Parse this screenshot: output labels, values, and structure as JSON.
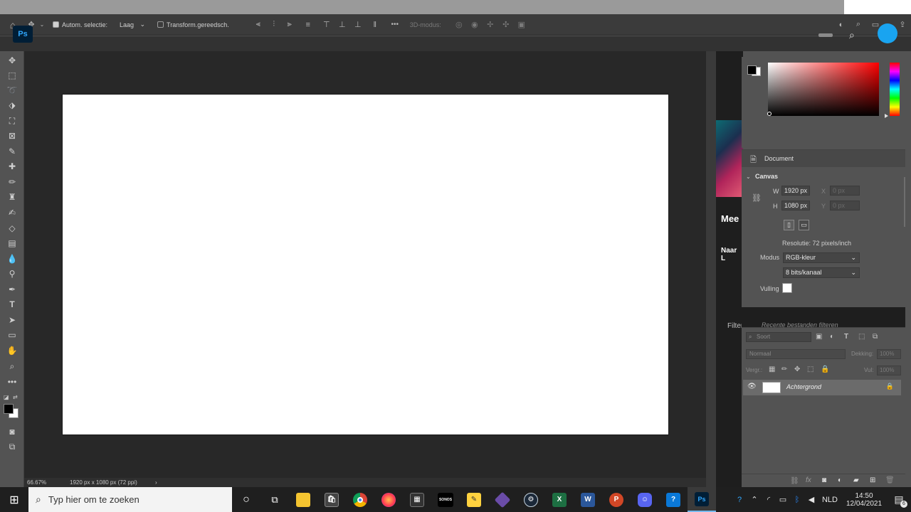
{
  "options_bar": {
    "auto_select_label": "Autom. selectie:",
    "auto_select_target": "Laag",
    "transform_controls_label": "Transform.gereedsch.",
    "more_label": "•••",
    "mode_3d_label": "3D-modus:"
  },
  "status": {
    "zoom": "66.67%",
    "doc_info": "1920 px x 1080 px (72 ppi)",
    "arrow": "›"
  },
  "home_panel": {
    "title_fragment": "Mee",
    "link_fragment": "Naar L",
    "filter_label": "Filters",
    "filter_placeholder": "Recente bestanden filteren"
  },
  "properties": {
    "tab_label": "Document",
    "section_title": "Canvas",
    "width_label": "W",
    "width_value": "1920 px",
    "height_label": "H",
    "height_value": "1080 px",
    "x_label": "X",
    "x_value": "0 px",
    "y_label": "Y",
    "y_value": "0 px",
    "resolution": "Resolutie: 72 pixels/inch",
    "mode_label": "Modus",
    "mode_value": "RGB-kleur",
    "depth_value": "8 bits/kanaal",
    "fill_label": "Vulling"
  },
  "layers": {
    "search_placeholder": "Soort",
    "blend_mode": "Normaal",
    "opacity_label": "Dekking:",
    "opacity_value": "100%",
    "lock_label": "Vergr.:",
    "fill_label": "Vul:",
    "fill_value": "100%",
    "layer_name": "Achtergrond"
  },
  "taskbar": {
    "search_placeholder": "Typ hier om te zoeken",
    "language": "NLD",
    "time": "14:50",
    "date": "12/04/2021",
    "notification_count": "6",
    "sonos_label": "SONOS"
  },
  "colors": {
    "foreground": "#000000",
    "background": "#ffffff",
    "accent": "#31a8ff"
  }
}
